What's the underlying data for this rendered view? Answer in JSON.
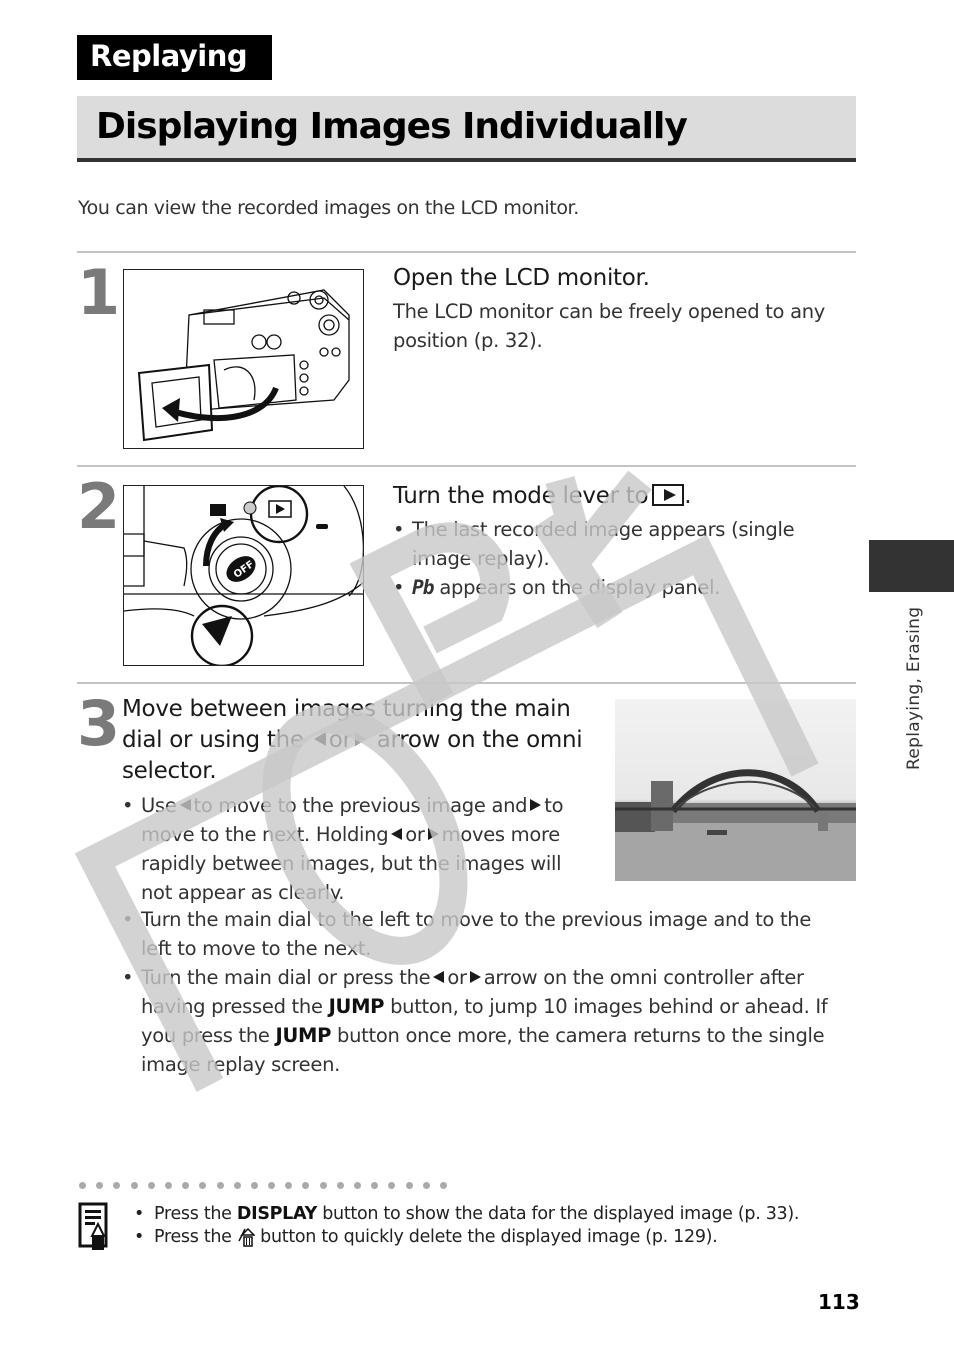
{
  "section_tag": "Replaying",
  "page_title": "Displaying Images Individually",
  "intro": "You can view the recorded images on the LCD monitor.",
  "steps": [
    {
      "number": "1",
      "heading": "Open the LCD monitor.",
      "body": "The LCD monitor can be freely opened to any position (p. 32).",
      "illustration": "camera-lcd-monitor-opening"
    },
    {
      "number": "2",
      "heading": "Turn the mode lever to",
      "heading_icon": "replay-icon",
      "heading_end": ".",
      "bullets": [
        "The last recorded image appears (single image replay).",
        {
          "symbol": "Pb",
          "text": "appears on the display panel."
        }
      ],
      "illustration": "mode-lever-closeup"
    },
    {
      "number": "3",
      "heading_parts": [
        "Move between images turning the main dial or using the",
        "or",
        "arrow on the omni selector."
      ],
      "bullets": {
        "b1": [
          "Use",
          "to move to the previous image and",
          "to move to the next. Holding",
          "or",
          "moves more rapidly between images, but the images will not appear as clearly."
        ],
        "b2": "Turn the main dial to the left to move to the previous image and to the left to move to the next.",
        "b3": [
          "Turn the main dial or press the",
          "or",
          "arrow on the omni controller after having pressed the",
          "JUMP",
          "button, to jump 10 images behind or ahead. If you press the",
          "JUMP",
          "button once more, the camera returns to the single image replay screen."
        ]
      },
      "photo": "harbour-bridge-sample-photo"
    }
  ],
  "notes": {
    "n1": [
      "Press the",
      "DISPLAY",
      "button to show the data for the displayed image (p. 33)."
    ],
    "n2": [
      "Press the",
      "button to quickly delete the displayed image (p. 129)."
    ],
    "n2_icon": "erase-icon"
  },
  "side_label": "Replaying, Erasing",
  "page_number": "113",
  "watermark": "COPY",
  "colors": {
    "tab": "#333333",
    "title_band": "#dcdcdc",
    "step_number": "#7a7a7a",
    "watermark": "#c8c8c8"
  }
}
